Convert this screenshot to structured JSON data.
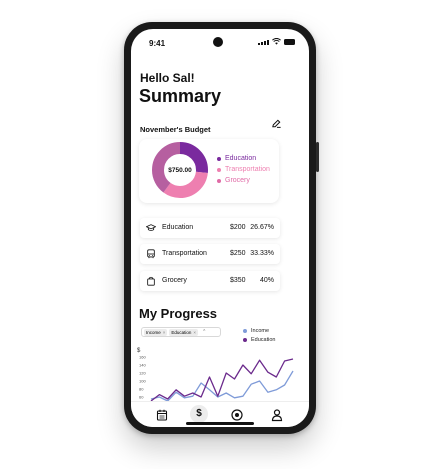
{
  "status_bar": {
    "time": "9:41"
  },
  "header": {
    "greeting": "Hello Sal!",
    "title": "Summary"
  },
  "budget": {
    "title": "November's Budget",
    "total": "$750.00",
    "segments": [
      {
        "name": "Education",
        "value": 200,
        "color": "#7a2a9e"
      },
      {
        "name": "Transportation",
        "value": 250,
        "color": "#ee7fb0"
      },
      {
        "name": "Grocery",
        "value": 300,
        "color": "#b65fa0"
      }
    ],
    "legend": [
      {
        "label": "Education",
        "color": "#7a2a9e"
      },
      {
        "label": "Transportation",
        "color": "#ee7fb0"
      },
      {
        "label": "Grocery",
        "color": "#e06aa6"
      }
    ]
  },
  "categories": [
    {
      "name": "Education",
      "amount": "$200",
      "percent": "26.67%",
      "icon": "graduation-cap-icon"
    },
    {
      "name": "Transportation",
      "amount": "$250",
      "percent": "33.33%",
      "icon": "bus-icon"
    },
    {
      "name": "Grocery",
      "amount": "$350",
      "percent": "40%",
      "icon": "shopping-bag-icon"
    }
  ],
  "progress": {
    "title": "My Progress",
    "filter_chips": [
      "Income",
      "Education"
    ],
    "legend": [
      {
        "label": "Income",
        "color": "#7f9bd8"
      },
      {
        "label": "Education",
        "color": "#6b2a8c"
      }
    ],
    "chart_data": {
      "type": "line",
      "ylabel": "$",
      "y_ticks": [
        "160",
        "140",
        "120",
        "100",
        "80",
        "60"
      ],
      "ylim": [
        40,
        170
      ],
      "series": [
        {
          "name": "Income",
          "color": "#7f9bd8",
          "values": [
            55,
            60,
            50,
            72,
            58,
            62,
            95,
            78,
            60,
            70,
            58,
            62,
            92,
            100,
            72,
            78,
            90,
            125
          ]
        },
        {
          "name": "Education",
          "color": "#6b2a8c",
          "values": [
            50,
            66,
            55,
            78,
            62,
            70,
            60,
            110,
            62,
            120,
            105,
            140,
            118,
            152,
            122,
            110,
            150,
            155
          ]
        }
      ]
    }
  },
  "nav": {
    "items": [
      {
        "name": "calendar-icon"
      },
      {
        "name": "dollar-icon",
        "glyph": "$"
      },
      {
        "name": "target-icon"
      },
      {
        "name": "profile-icon"
      }
    ]
  }
}
